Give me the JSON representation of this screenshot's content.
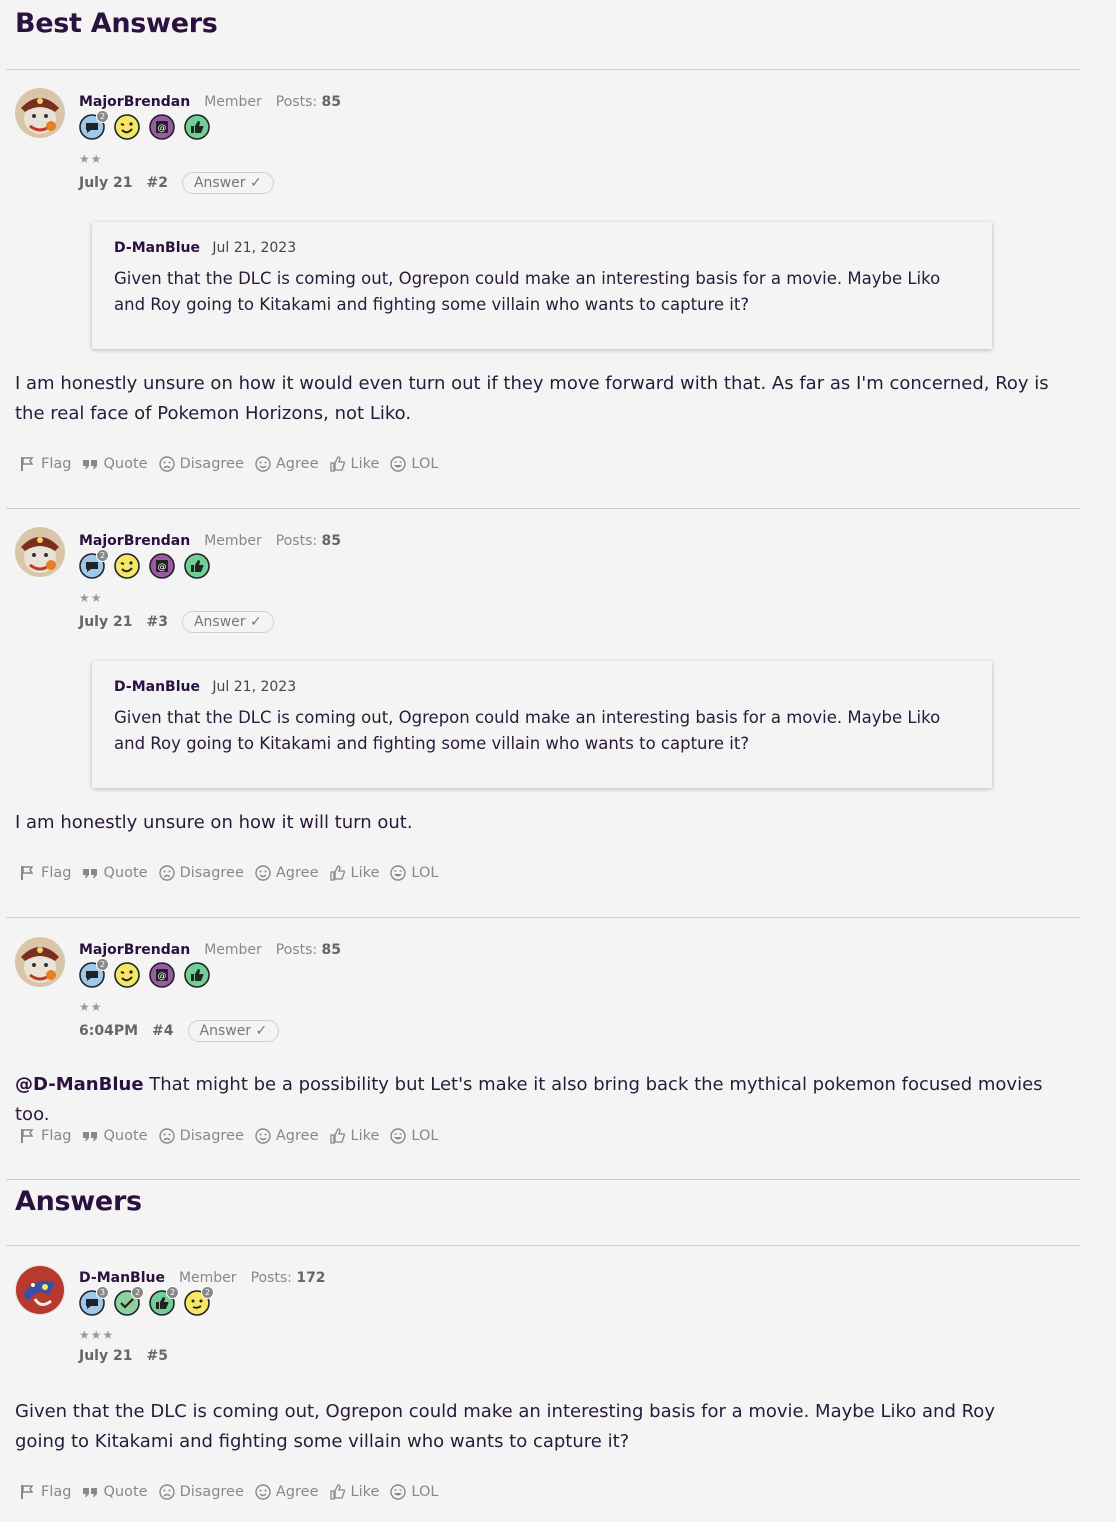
{
  "best_answers_title": "Best Answers",
  "answers_title": "Answers",
  "actions": {
    "flag": "Flag",
    "quote": "Quote",
    "disagree": "Disagree",
    "agree": "Agree",
    "like": "Like",
    "lol": "LOL"
  },
  "answer_button": "Answer ✓",
  "posts": [
    {
      "author": "MajorBrendan",
      "role": "Member",
      "posts_label": "Posts:",
      "post_count": "85",
      "rank_stars": "★★",
      "date": "July 21",
      "number": "#2",
      "quote": {
        "author": "D-ManBlue",
        "date": "Jul 21, 2023",
        "text": "Given that the DLC is coming out, Ogrepon could make an interesting basis for a movie. Maybe Liko and Roy going to Kitakami and fighting some villain who wants to capture it?"
      },
      "body": "I am honestly unsure on how it would even turn out if they move forward with that. As far as I'm concerned, Roy is the real face of Pokemon Horizons, not Liko."
    },
    {
      "author": "MajorBrendan",
      "role": "Member",
      "posts_label": "Posts:",
      "post_count": "85",
      "rank_stars": "★★",
      "date": "July 21",
      "number": "#3",
      "quote": {
        "author": "D-ManBlue",
        "date": "Jul 21, 2023",
        "text": "Given that the DLC is coming out, Ogrepon could make an interesting basis for a movie. Maybe Liko and Roy going to Kitakami and fighting some villain who wants to capture it?"
      },
      "body": "I am honestly unsure on how it will turn out."
    },
    {
      "author": "MajorBrendan",
      "role": "Member",
      "posts_label": "Posts:",
      "post_count": "85",
      "rank_stars": "★★",
      "date": "6:04PM",
      "number": "#4",
      "mention": "@D-ManBlue",
      "body": " That might be a possibility but Let's make it also bring back the mythical pokemon focused movies too."
    },
    {
      "author": "D-ManBlue",
      "role": "Member",
      "posts_label": "Posts:",
      "post_count": "172",
      "rank_stars": "★★★",
      "date": "July 21",
      "number": "#5",
      "body": "Given that the DLC is coming out, Ogrepon could make an interesting basis for a movie. Maybe Liko and Roy going to Kitakami and fighting some villain who wants to capture it?"
    }
  ],
  "badge_counts": {
    "post1_comment": "2",
    "dman_comment": "3",
    "dman_check": "2",
    "dman_like": "2",
    "dman_face": "2"
  }
}
